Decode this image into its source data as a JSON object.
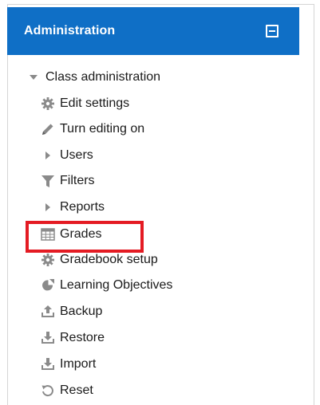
{
  "block": {
    "title": "Administration",
    "collapse_icon": "minus-square-icon"
  },
  "tree": {
    "root": {
      "label": "Class administration",
      "icon": "caret-down-icon"
    },
    "items": [
      {
        "label": "Edit settings",
        "icon": "gear-icon"
      },
      {
        "label": "Turn editing on",
        "icon": "pencil-icon"
      },
      {
        "label": "Users",
        "icon": "caret-right-icon"
      },
      {
        "label": "Filters",
        "icon": "filter-icon"
      },
      {
        "label": "Reports",
        "icon": "caret-right-icon"
      },
      {
        "label": "Grades",
        "icon": "table-icon",
        "highlighted": true
      },
      {
        "label": "Gradebook setup",
        "icon": "gear-icon"
      },
      {
        "label": "Learning Objectives",
        "icon": "objectives-icon"
      },
      {
        "label": "Backup",
        "icon": "upload-tray-icon"
      },
      {
        "label": "Restore",
        "icon": "download-tray-icon"
      },
      {
        "label": "Import",
        "icon": "download-tray-icon"
      },
      {
        "label": "Reset",
        "icon": "reset-icon"
      }
    ]
  },
  "colors": {
    "header_bg": "#0f6fc6",
    "highlight_border": "#e41b23",
    "icon_gray": "#8a8a8a"
  }
}
